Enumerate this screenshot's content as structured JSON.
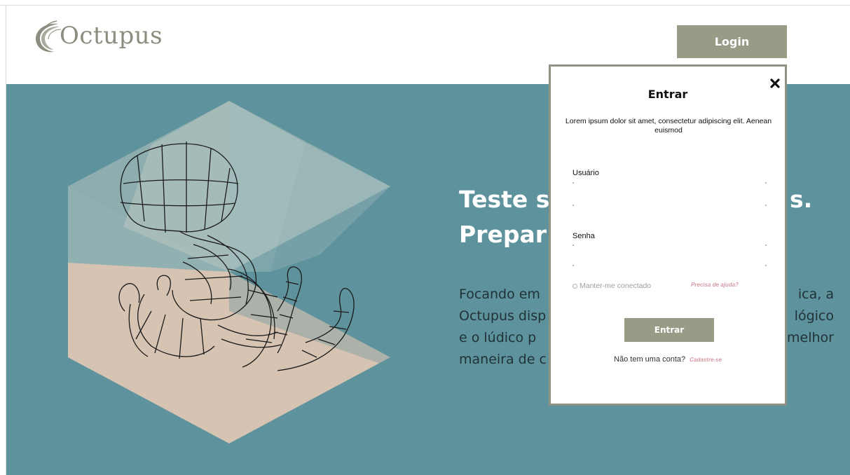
{
  "header": {
    "logo_text": "Octupus",
    "login_label": "Login"
  },
  "hero": {
    "headline_line1": "Teste s",
    "headline_line1_end": "s.",
    "headline_line2": "Prepar",
    "description": "Focando em ... ica, a Octupus disp ... lógico e o lúdico p ... melhor maneira de c",
    "description_lines": [
      {
        "start": "Focando em",
        "end": "ica, a"
      },
      {
        "start": "Octupus disp",
        "end": "lógico"
      },
      {
        "start": "e o lúdico p",
        "end": "melhor"
      },
      {
        "start": "maneira de c",
        "end": ""
      }
    ]
  },
  "modal": {
    "title": "Entrar",
    "subtitle": "Lorem ipsum dolor sit amet, consectetur adipiscing elit. Aenean euismod",
    "username_label": "Usuário",
    "password_label": "Senha",
    "remember_label": "Manter-me conectado",
    "help_label": "Precisa de ajuda?",
    "submit_label": "Entrar",
    "no_account_text": "Não tem uma conta?",
    "signup_label": "Cadastre-se"
  },
  "colors": {
    "accent": "#969c86",
    "hero_bg": "#5e929c",
    "link_pink": "#d69aa4",
    "panel_peach": "#d6c3b1"
  },
  "icons": [
    "close-icon",
    "octupus-logo-icon",
    "radio-icon"
  ]
}
